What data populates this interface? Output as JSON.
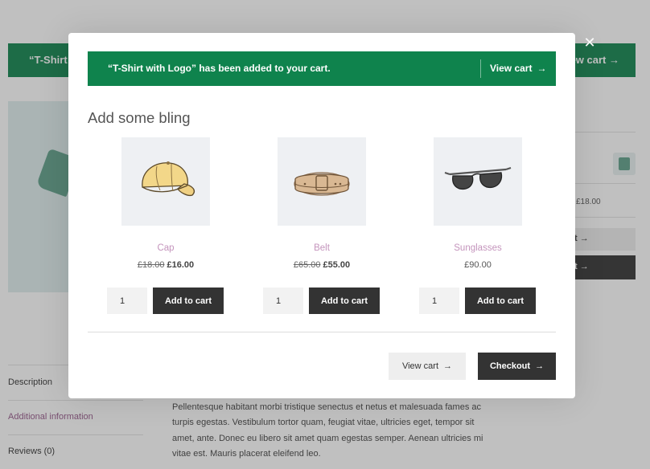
{
  "background": {
    "notice_text": "“T-Shirt w",
    "notice_link": "iew cart",
    "sidebar_price": "£18.00",
    "sidebar_btn_light": "t",
    "sidebar_btn_dark": "t",
    "tabs": [
      "Description",
      "Additional information",
      "Reviews (0)"
    ],
    "description": "Pellentesque habitant morbi tristique senectus et netus et malesuada fames ac turpis egestas. Vestibulum tortor quam, feugiat vitae, ultricies eget, tempor sit amet, ante. Donec eu libero sit amet quam egestas semper. Aenean ultricies mi vitae est. Mauris placerat eleifend leo."
  },
  "modal": {
    "close_label": "✕",
    "notice": {
      "message": "“T-Shirt with Logo” has been added to your cart.",
      "link": "View cart"
    },
    "heading": "Add some bling",
    "products": [
      {
        "name": "Cap",
        "old_price": "£18.00",
        "price": "£16.00",
        "qty": "1",
        "button": "Add to cart"
      },
      {
        "name": "Belt",
        "old_price": "£65.00",
        "price": "£55.00",
        "qty": "1",
        "button": "Add to cart"
      },
      {
        "name": "Sunglasses",
        "price": "£90.00",
        "qty": "1",
        "button": "Add to cart"
      }
    ],
    "footer": {
      "view_cart": "View cart",
      "checkout": "Checkout"
    }
  },
  "icons": {
    "arrow": "→",
    "arrow_name": "arrow-right-icon"
  },
  "colors": {
    "notice_green": "#0f834d",
    "button_dark": "#333333",
    "product_link": "#c494bc"
  }
}
